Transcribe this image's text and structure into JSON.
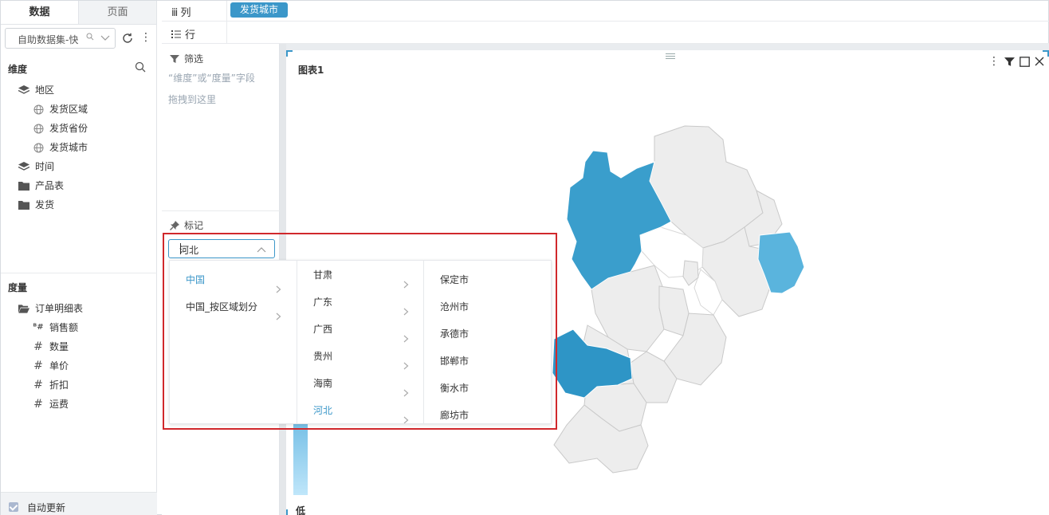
{
  "left_panel": {
    "tabs": [
      "数据",
      "页面"
    ],
    "dataset": {
      "name": "自助数据集-快",
      "search_icon": "search-icon"
    },
    "dimension_title": "维度",
    "dimensions": [
      {
        "label": "地区",
        "icon": "layers-icon",
        "level": 0
      },
      {
        "label": "发货区域",
        "icon": "globe-icon",
        "level": 1
      },
      {
        "label": "发货省份",
        "icon": "globe-icon",
        "level": 1
      },
      {
        "label": "发货城市",
        "icon": "globe-icon",
        "level": 1
      },
      {
        "label": "时间",
        "icon": "layers-icon",
        "level": 0
      },
      {
        "label": "产品表",
        "icon": "folder-icon",
        "level": 0
      },
      {
        "label": "发货",
        "icon": "folder-icon",
        "level": 0
      }
    ],
    "measure_title": "度量",
    "measures": [
      {
        "label": "订单明细表",
        "icon": "folder-open-icon",
        "level": 0
      },
      {
        "label": "销售额",
        "icon": "calc-field-icon",
        "level": 1
      },
      {
        "label": "数量",
        "icon": "hash-icon",
        "level": 1
      },
      {
        "label": "单价",
        "icon": "hash-icon",
        "level": 1
      },
      {
        "label": "折扣",
        "icon": "hash-icon",
        "level": 1
      },
      {
        "label": "运费",
        "icon": "hash-icon",
        "level": 1
      }
    ],
    "auto_update": {
      "label": "自动更新",
      "checked": true
    }
  },
  "shelves": {
    "column_label": "列",
    "row_label": "行",
    "column_pill": "发货城市"
  },
  "filter_panel": {
    "title": "筛选",
    "hint_line1": "“维度”或“度量”字段",
    "hint_line2": "拖拽到这里",
    "mark_title": "标记"
  },
  "chart": {
    "title": "图表1",
    "legend_low": "低",
    "colors": {
      "dark": "#2e95c6",
      "mid": "#3a9ecc",
      "light": "#5ab4dd",
      "empty": "#ededed",
      "border": "#c9c9c9"
    }
  },
  "map_picker": {
    "value": "河北",
    "level1": [
      {
        "label": "中国",
        "selected": true
      },
      {
        "label": "中国_按区域划分",
        "selected": false
      }
    ],
    "level2": [
      {
        "label": "甘肃",
        "selected": false
      },
      {
        "label": "广东",
        "selected": false
      },
      {
        "label": "广西",
        "selected": false
      },
      {
        "label": "贵州",
        "selected": false
      },
      {
        "label": "海南",
        "selected": false
      },
      {
        "label": "河北",
        "selected": true
      }
    ],
    "level3": [
      "保定市",
      "沧州市",
      "承德市",
      "邯郸市",
      "衡水市",
      "廊坊市"
    ]
  }
}
